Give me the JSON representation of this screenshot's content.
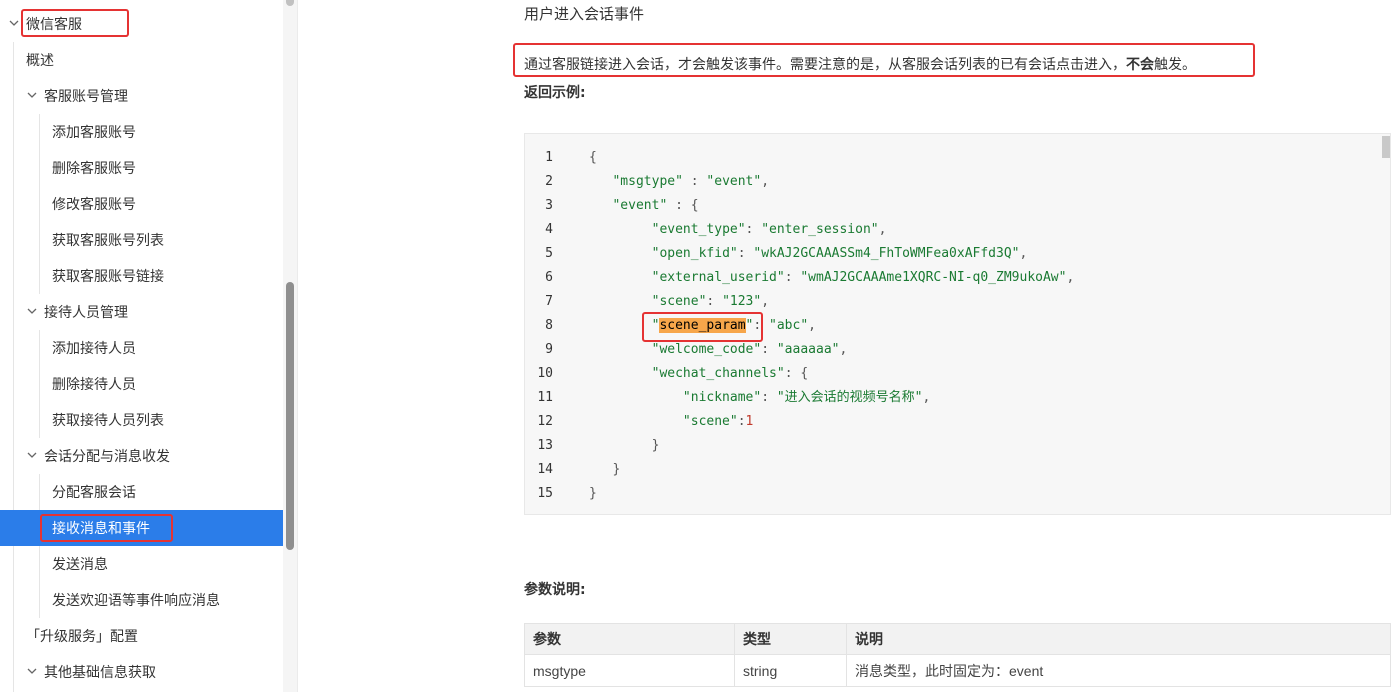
{
  "sidebar": {
    "items": [
      {
        "label": "微信客服"
      },
      {
        "label": "概述"
      },
      {
        "label": "客服账号管理"
      },
      {
        "label": "添加客服账号"
      },
      {
        "label": "删除客服账号"
      },
      {
        "label": "修改客服账号"
      },
      {
        "label": "获取客服账号列表"
      },
      {
        "label": "获取客服账号链接"
      },
      {
        "label": "接待人员管理"
      },
      {
        "label": "添加接待人员"
      },
      {
        "label": "删除接待人员"
      },
      {
        "label": "获取接待人员列表"
      },
      {
        "label": "会话分配与消息收发"
      },
      {
        "label": "分配客服会话"
      },
      {
        "label": "接收消息和事件"
      },
      {
        "label": "发送消息"
      },
      {
        "label": "发送欢迎语等事件响应消息"
      },
      {
        "label": "「升级服务」配置"
      },
      {
        "label": "其他基础信息获取"
      }
    ]
  },
  "main": {
    "section_title": "用户进入会话事件",
    "description_pre": "通过客服链接进入会话，才会触发该事件。需要注意的是，从客服会话列表的已有会话点击进入，",
    "description_bold": "不会",
    "description_post": "触发。",
    "example_heading": "返回示例:",
    "params_heading": "参数说明:",
    "code": {
      "line_numbers": [
        "1",
        "2",
        "3",
        "4",
        "5",
        "6",
        "7",
        "8",
        "9",
        "10",
        "11",
        "12",
        "13",
        "14",
        "15"
      ],
      "l2_key": "\"msgtype\"",
      "l2_val": "\"event\"",
      "l3_key": "\"event\"",
      "l4_key": "\"event_type\"",
      "l4_val": "\"enter_session\"",
      "l5_key": "\"open_kfid\"",
      "l5_val": "\"wkAJ2GCAAASSm4_FhToWMFea0xAFfd3Q\"",
      "l6_key": "\"external_userid\"",
      "l6_val": "\"wmAJ2GCAAAme1XQRC-NI-q0_ZM9ukoAw\"",
      "l7_key": "\"scene\"",
      "l7_val": "\"123\"",
      "l8_key_inner": "scene_param",
      "l8_val": "\"abc\"",
      "l9_key": "\"welcome_code\"",
      "l9_val": "\"aaaaaa\"",
      "l10_key": "\"wechat_channels\"",
      "l11_key": "\"nickname\"",
      "l11_val": "\"进入会话的视频号名称\"",
      "l12_key": "\"scene\"",
      "l12_val": "1"
    },
    "table": {
      "headers": [
        "参数",
        "类型",
        "说明"
      ],
      "rows": [
        [
          "msgtype",
          "string",
          "消息类型，此时固定为：event"
        ]
      ]
    }
  },
  "colors": {
    "accent": "#2b7de9",
    "annotation": "#e53333",
    "highlight": "#f7a64a",
    "code_string": "#1a7a32",
    "code_number": "#c0392b"
  }
}
